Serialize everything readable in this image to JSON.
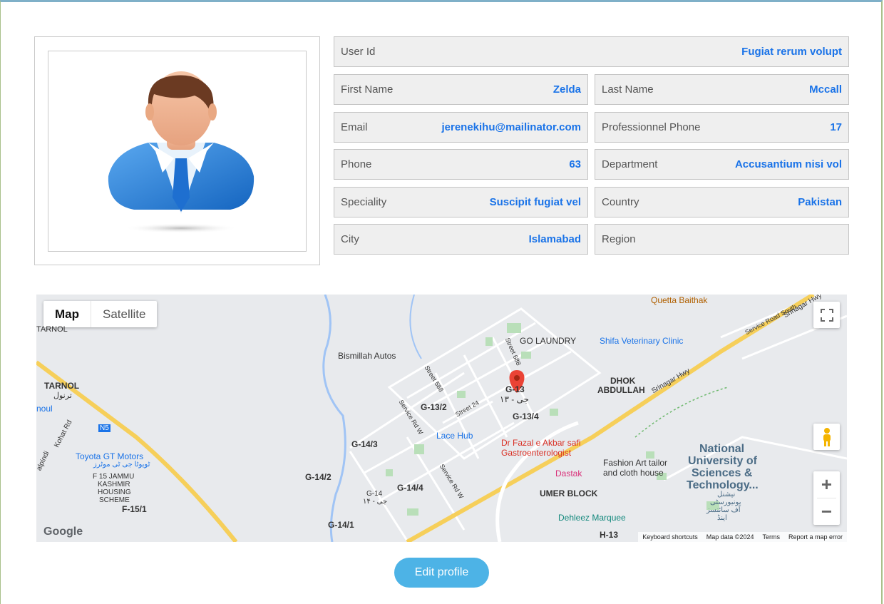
{
  "profile": {
    "fields": [
      {
        "label": "User Id",
        "value": "Fugiat rerum volupt"
      },
      {
        "label": "First Name",
        "value": "Zelda"
      },
      {
        "label": "Last Name",
        "value": "Mccall"
      },
      {
        "label": "Email",
        "value": "jerenekihu@mailinator.com"
      },
      {
        "label": "Professionnel Phone",
        "value": "17"
      },
      {
        "label": "Phone",
        "value": "63"
      },
      {
        "label": "Department",
        "value": "Accusantium nisi vol"
      },
      {
        "label": "Speciality",
        "value": "Suscipit fugiat vel"
      },
      {
        "label": "Country",
        "value": "Pakistan"
      },
      {
        "label": "City",
        "value": "Islamabad"
      },
      {
        "label": "Region",
        "value": ""
      }
    ]
  },
  "map": {
    "type_map": "Map",
    "type_satellite": "Satellite",
    "zoom_in": "+",
    "zoom_out": "−",
    "brand": "Google",
    "footer": {
      "shortcuts": "Keyboard shortcuts",
      "data": "Map data ©2024",
      "terms": "Terms",
      "report": "Report a map error"
    },
    "places": {
      "quetta": "Quetta Baithak",
      "laundry": "GO LAUNDRY",
      "shifa": "Shifa Veterinary Clinic",
      "bismillah": "Bismillah Autos",
      "tarnol": "TARNOL",
      "tarnol_ur": "ترنول",
      "tarnol_top": "TARNOL",
      "dhok1": "DHOK",
      "dhok2": "ABDULLAH",
      "g13": "G-13",
      "g13_ur": "جی - ۱۳",
      "g132": "G-13/2",
      "g134": "G-13/4",
      "lace": "Lace Hub",
      "drfazal1": "Dr Fazal e Akbar safi",
      "drfazal2": "Gastroenterologist",
      "toyota": "Toyota GT Motors",
      "toyota_ur": "ٹویوٹا جی ٹی موٹرز",
      "g143": "G-14/3",
      "g142": "G-14/2",
      "g144": "G-14/4",
      "g14": "G-14",
      "g14_ur": "جی - ۱۴",
      "g141": "G-14/1",
      "f15a": "F 15 JAMMU",
      "f15b": "KASHMIR",
      "f15c": "HOUSING",
      "f15d": "SCHEME",
      "f151": "F-15/1",
      "dastak": "Dastak",
      "fashion1": "Fashion Art tailor",
      "fashion2": "and cloth house",
      "umer": "UMER BLOCK",
      "nust1": "National",
      "nust2": "University of",
      "nust3": "Sciences &",
      "nust4": "Technology...",
      "nust_ur1": "نیشنل",
      "nust_ur2": "یونیورسٹی",
      "nust_ur3": "آف سائنسز",
      "nust_ur4": "اینڈ",
      "dehleez": "Dehleez Marquee",
      "h13": "H-13",
      "srinagar1": "Srinagar Hwy",
      "srinagar2": "Srinagar Hwy",
      "kohat": "Kohat Rd",
      "n5": "N5",
      "servicesouth": "Service Road South",
      "st688": "Street 688",
      "st588": "Street 588",
      "st24": "Street 24",
      "servrd": "Service Rd W",
      "servrd2": "Service Rd W",
      "pindi": "alpindi",
      "noul": "noul"
    }
  },
  "actions": {
    "edit_profile": "Edit profile"
  }
}
